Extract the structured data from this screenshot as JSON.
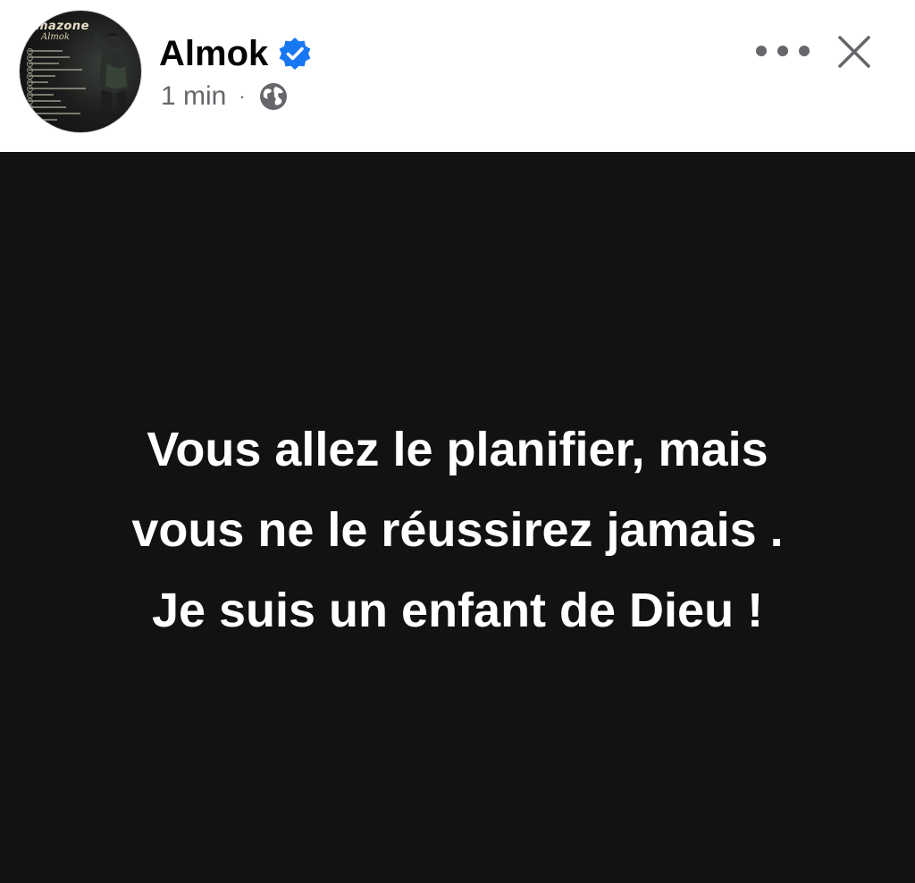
{
  "author": {
    "name": "Almok",
    "verified": true,
    "avatar_text": "mazone",
    "avatar_script": "Almok"
  },
  "meta": {
    "time": "1 min",
    "separator": "·",
    "privacy_icon": "globe-icon"
  },
  "actions": {
    "more_icon": "more-horizontal-icon",
    "close_icon": "close-icon"
  },
  "post": {
    "background": "#121212",
    "text_color": "#ffffff",
    "text": "Vous allez le planifier, mais\nvous ne le réussirez jamais .\n  Je suis un enfant de Dieu !"
  },
  "colors": {
    "verified_badge": "#1877f2",
    "secondary_text": "#65676b",
    "primary_text": "#050505"
  }
}
